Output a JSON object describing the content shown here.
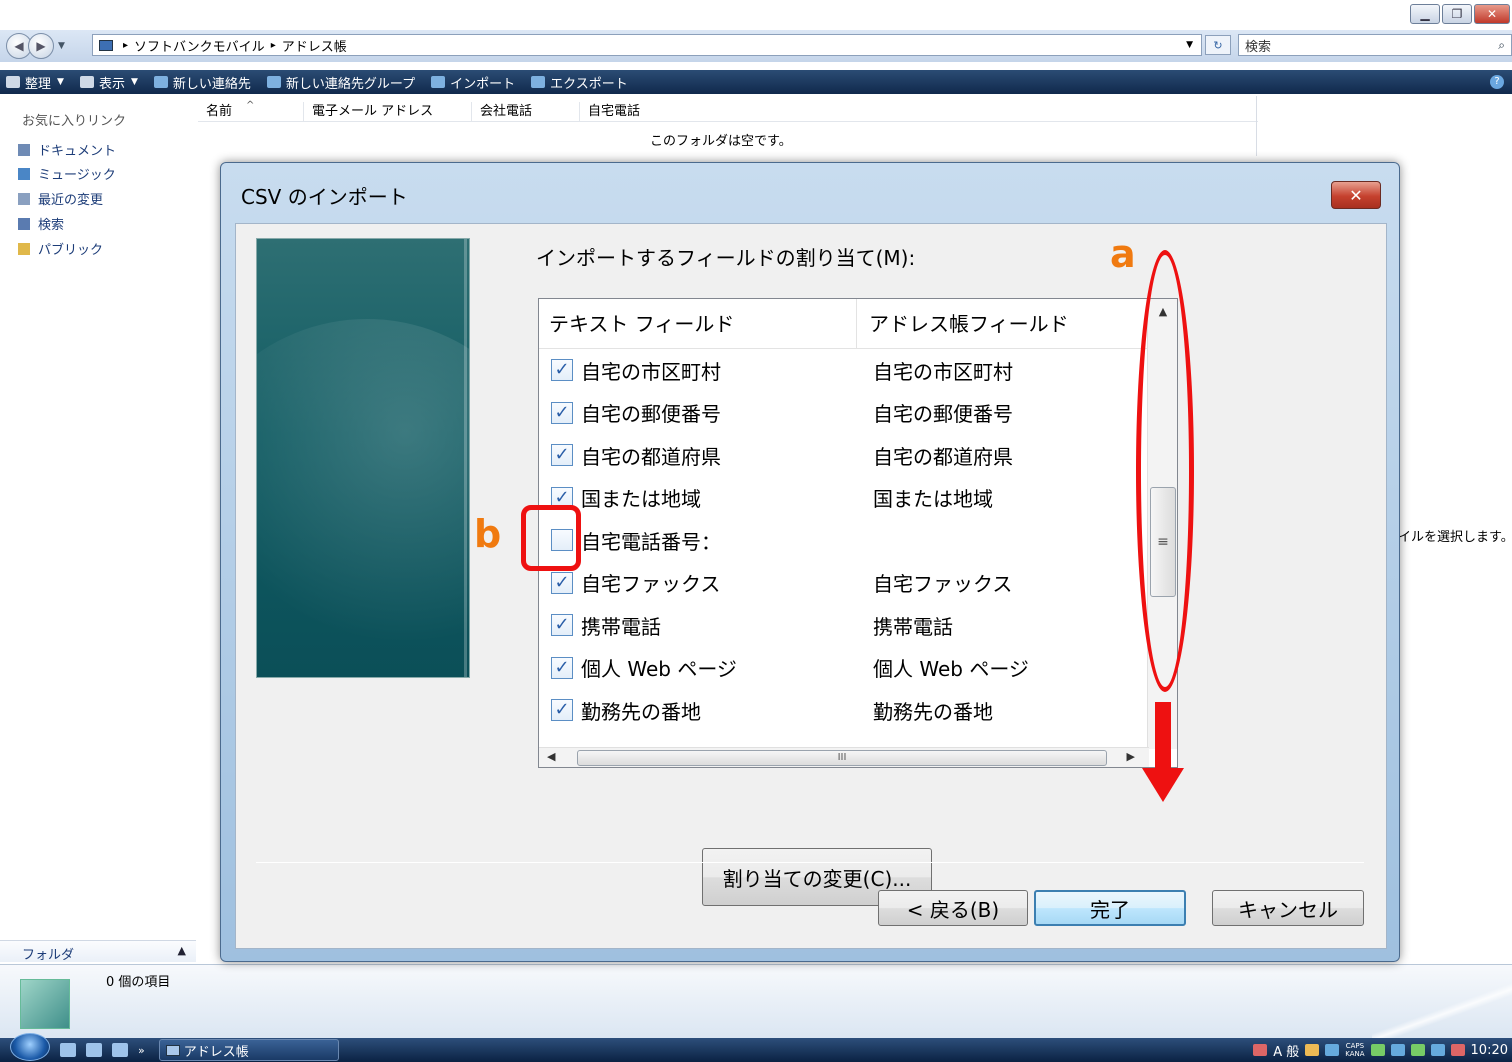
{
  "explorer": {
    "breadcrumb": [
      "ソフトバンクモバイル",
      "アドレス帳"
    ],
    "search_placeholder": "検索",
    "toolbar": {
      "organize": "整理",
      "views": "表示",
      "new_contact": "新しい連絡先",
      "new_group": "新しい連絡先グループ",
      "import": "インポート",
      "export": "エクスポート"
    },
    "sidebar": {
      "heading": "お気に入りリンク",
      "links": [
        "ドキュメント",
        "ミュージック",
        "最近の変更",
        "検索",
        "パブリック"
      ],
      "folders_label": "フォルダ"
    },
    "columns": [
      "名前",
      "電子メール アドレス",
      "会社電話",
      "自宅電話"
    ],
    "empty_message": "このフォルダは空です。",
    "right_edge_text": "イルを選択します。",
    "item_count": "0 個の項目"
  },
  "taskbar": {
    "task_label": "アドレス帳",
    "ime": "A 般",
    "clock": "10:20"
  },
  "dialog": {
    "title": "CSV のインポート",
    "map_label": "インポートするフィールドの割り当て(M):",
    "col_text": "テキスト フィールド",
    "col_address": "アドレス帳フィールド",
    "rows": [
      {
        "text": "自宅の市区町村",
        "address": "自宅の市区町村",
        "checked": true
      },
      {
        "text": "自宅の郵便番号",
        "address": "自宅の郵便番号",
        "checked": true
      },
      {
        "text": "自宅の都道府県",
        "address": "自宅の都道府県",
        "checked": true
      },
      {
        "text": "国または地域",
        "address": "国または地域",
        "checked": true
      },
      {
        "text": "自宅電話番号：",
        "address": "",
        "checked": false
      },
      {
        "text": "自宅ファックス",
        "address": "自宅ファックス",
        "checked": true
      },
      {
        "text": "携帯電話",
        "address": "携帯電話",
        "checked": true
      },
      {
        "text": "個人 Web ページ",
        "address": "個人 Web ページ",
        "checked": true
      },
      {
        "text": "勤務先の番地",
        "address": "勤務先の番地",
        "checked": true
      }
    ],
    "change_mapping_button": "割り当ての変更(C)...",
    "back_button": "< 戻る(B)",
    "finish_button": "完了",
    "cancel_button": "キャンセル"
  },
  "annotations": {
    "label_a": "a",
    "label_b": "b",
    "color": "#ee1111",
    "letter_color": "#f07a10"
  }
}
